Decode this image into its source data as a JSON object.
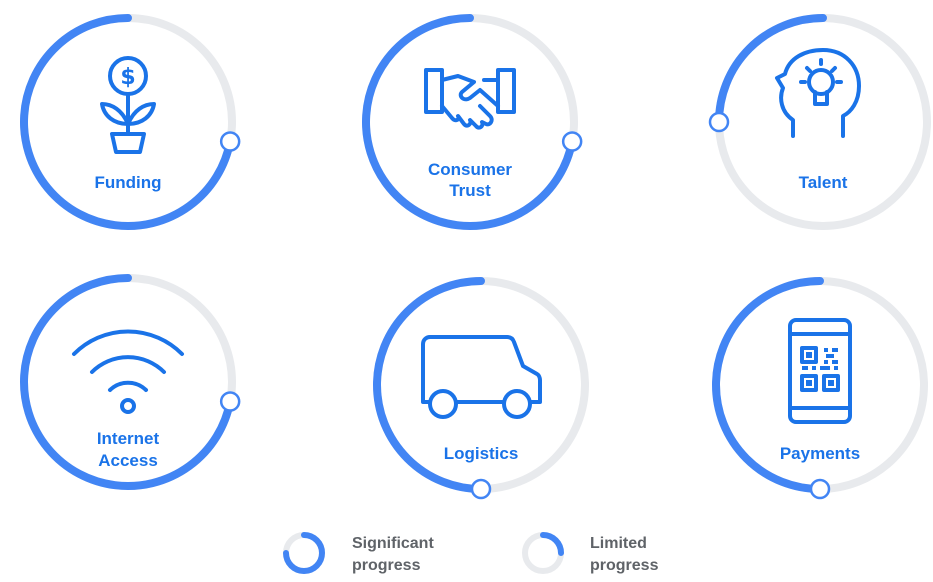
{
  "colors": {
    "track": "#e8eaed",
    "progress": "#4285f4",
    "icon": "#1a73e8",
    "handle_stroke": "#4285f4",
    "legend_text": "#5f6368"
  },
  "categories": [
    {
      "id": "funding",
      "icon": "money-plant-icon",
      "label_lines": [
        "Funding"
      ],
      "progress": 0.72
    },
    {
      "id": "consumer-trust",
      "icon": "handshake-icon",
      "label_lines": [
        "Consumer",
        "Trust"
      ],
      "progress": 0.72
    },
    {
      "id": "talent",
      "icon": "head-lightbulb-icon",
      "label_lines": [
        "Talent"
      ],
      "progress": 0.25
    },
    {
      "id": "internet-access",
      "icon": "wifi-icon",
      "label_lines": [
        "Internet",
        "Access"
      ],
      "progress": 0.72
    },
    {
      "id": "logistics",
      "icon": "delivery-van-icon",
      "label_lines": [
        "Logistics"
      ],
      "progress": 0.5
    },
    {
      "id": "payments",
      "icon": "phone-qr-code-icon",
      "label_lines": [
        "Payments"
      ],
      "progress": 0.5
    }
  ],
  "legend": {
    "significant": {
      "line1": "Significant",
      "line2": "progress"
    },
    "limited": {
      "line1": "Limited",
      "line2": "progress"
    }
  }
}
